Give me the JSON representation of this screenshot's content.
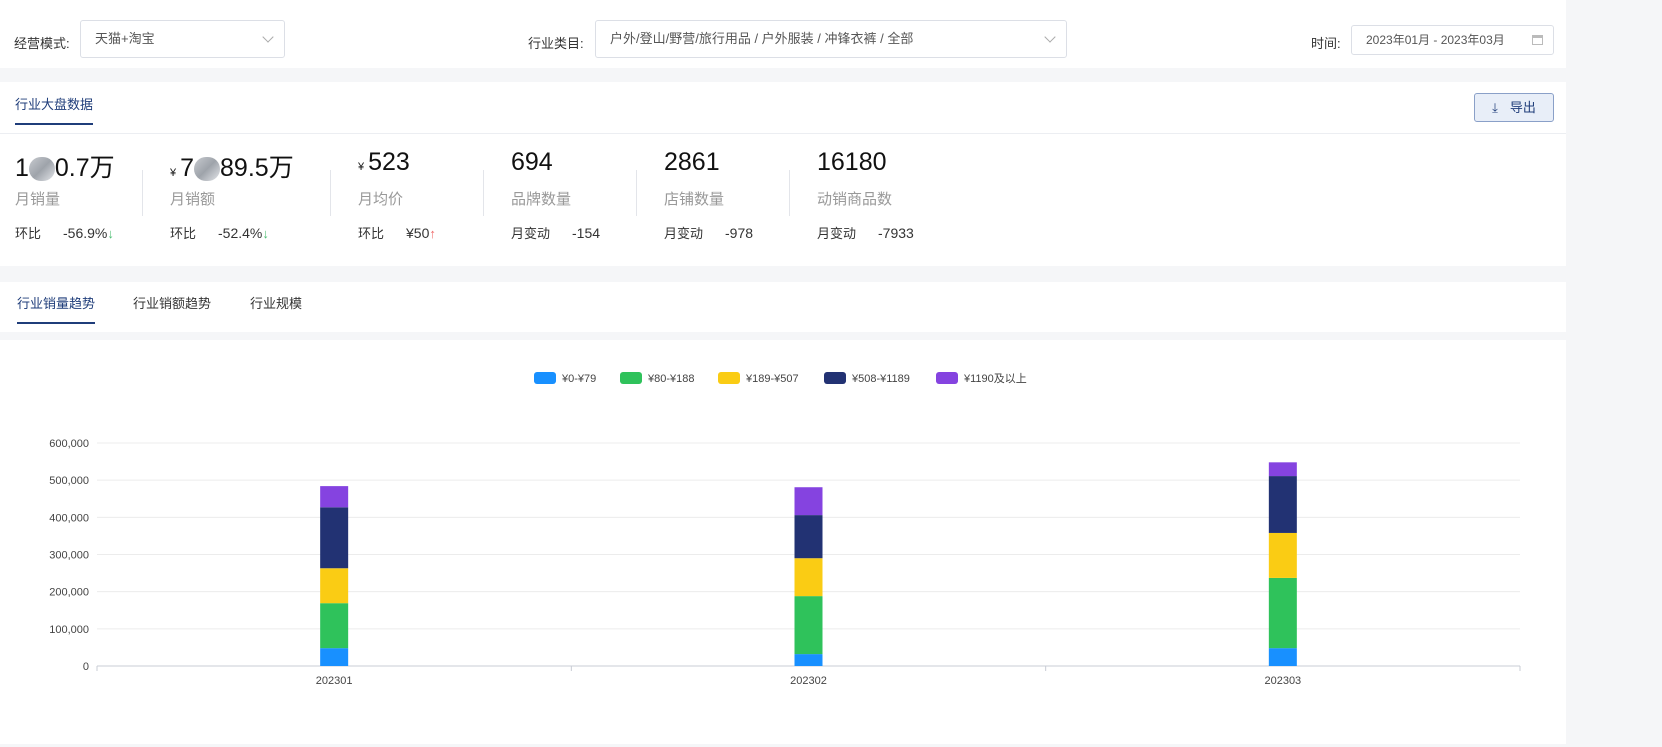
{
  "filter": {
    "mode_label": "经营模式:",
    "mode_value": "天猫+淘宝",
    "category_label": "行业类目:",
    "category_value": "户外/登山/野营/旅行用品 / 户外服装 / 冲锋衣裤 / 全部",
    "time_label": "时间:",
    "time_value": "2023年01月 - 2023年03月"
  },
  "overview": {
    "tab": "行业大盘数据",
    "export_label": "导出",
    "stats": [
      {
        "prefix": "",
        "value_a": "1",
        "value_b": "0.7万",
        "label": "月销量",
        "change_label": "环比",
        "change": "-56.9%",
        "dir": "down"
      },
      {
        "prefix": "¥",
        "value_a": "7",
        "value_b": "89.5万",
        "label": "月销额",
        "change_label": "环比",
        "change": "-52.4%",
        "dir": "down"
      },
      {
        "prefix": "¥",
        "value_a": "523",
        "value_b": "",
        "label": "月均价",
        "change_label": "环比",
        "change": "¥50",
        "dir": "up"
      },
      {
        "prefix": "",
        "value_a": "694",
        "value_b": "",
        "label": "品牌数量",
        "change_label": "月变动",
        "change": "-154",
        "dir": ""
      },
      {
        "prefix": "",
        "value_a": "2861",
        "value_b": "",
        "label": "店铺数量",
        "change_label": "月变动",
        "change": "-978",
        "dir": ""
      },
      {
        "prefix": "",
        "value_a": "16180",
        "value_b": "",
        "label": "动销商品数",
        "change_label": "月变动",
        "change": "-7933",
        "dir": ""
      }
    ]
  },
  "trend_tabs": [
    {
      "label": "行业销量趋势",
      "active": true
    },
    {
      "label": "行业销额趋势"
    },
    {
      "label": "行业规模"
    }
  ],
  "chart_data": {
    "type": "bar",
    "stacked": true,
    "categories": [
      "202301",
      "202302",
      "202303"
    ],
    "ylim": [
      0,
      600000
    ],
    "yticks": [
      "0",
      "100,000",
      "200,000",
      "300,000",
      "400,000",
      "500,000",
      "600,000"
    ],
    "grid": true,
    "legend_position": "top",
    "series": [
      {
        "name": "¥0-¥79",
        "color": "#1890ff",
        "values": [
          48000,
          32000,
          48000
        ]
      },
      {
        "name": "¥80-¥188",
        "color": "#2fc25b",
        "values": [
          121000,
          156000,
          189000
        ]
      },
      {
        "name": "¥189-¥507",
        "color": "#facc14",
        "values": [
          94000,
          102000,
          121000
        ]
      },
      {
        "name": "¥508-¥1189",
        "color": "#223273",
        "values": [
          164000,
          116000,
          153000
        ]
      },
      {
        "name": "¥1190及以上",
        "color": "#8543e0",
        "values": [
          57000,
          75000,
          37000
        ]
      }
    ]
  }
}
